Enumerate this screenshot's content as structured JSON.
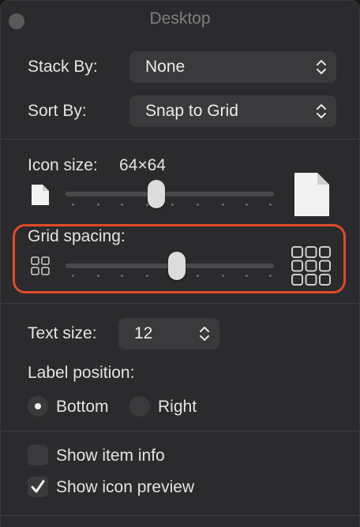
{
  "window": {
    "title": "Desktop"
  },
  "stack_by": {
    "label": "Stack By:",
    "value": "None"
  },
  "sort_by": {
    "label": "Sort By:",
    "value": "Snap to Grid"
  },
  "icon_size": {
    "label": "Icon size:",
    "value": "64×64",
    "level": 0.44
  },
  "grid_spacing": {
    "label": "Grid spacing:",
    "level": 0.53
  },
  "text_size": {
    "label": "Text size:",
    "value": "12"
  },
  "label_position": {
    "label": "Label position:",
    "options": [
      {
        "label": "Bottom",
        "selected": true
      },
      {
        "label": "Right",
        "selected": false
      }
    ]
  },
  "checkboxes": [
    {
      "label": "Show item info",
      "checked": false
    },
    {
      "label": "Show icon preview",
      "checked": true
    }
  ],
  "colors": {
    "highlight": "#e04a2b",
    "background": "#2b2b2d"
  },
  "icons": [
    "close-icon",
    "popup-chevron-icon",
    "small-file-icon",
    "large-file-icon",
    "small-grid-icon",
    "large-grid-icon",
    "checkmark-icon"
  ]
}
